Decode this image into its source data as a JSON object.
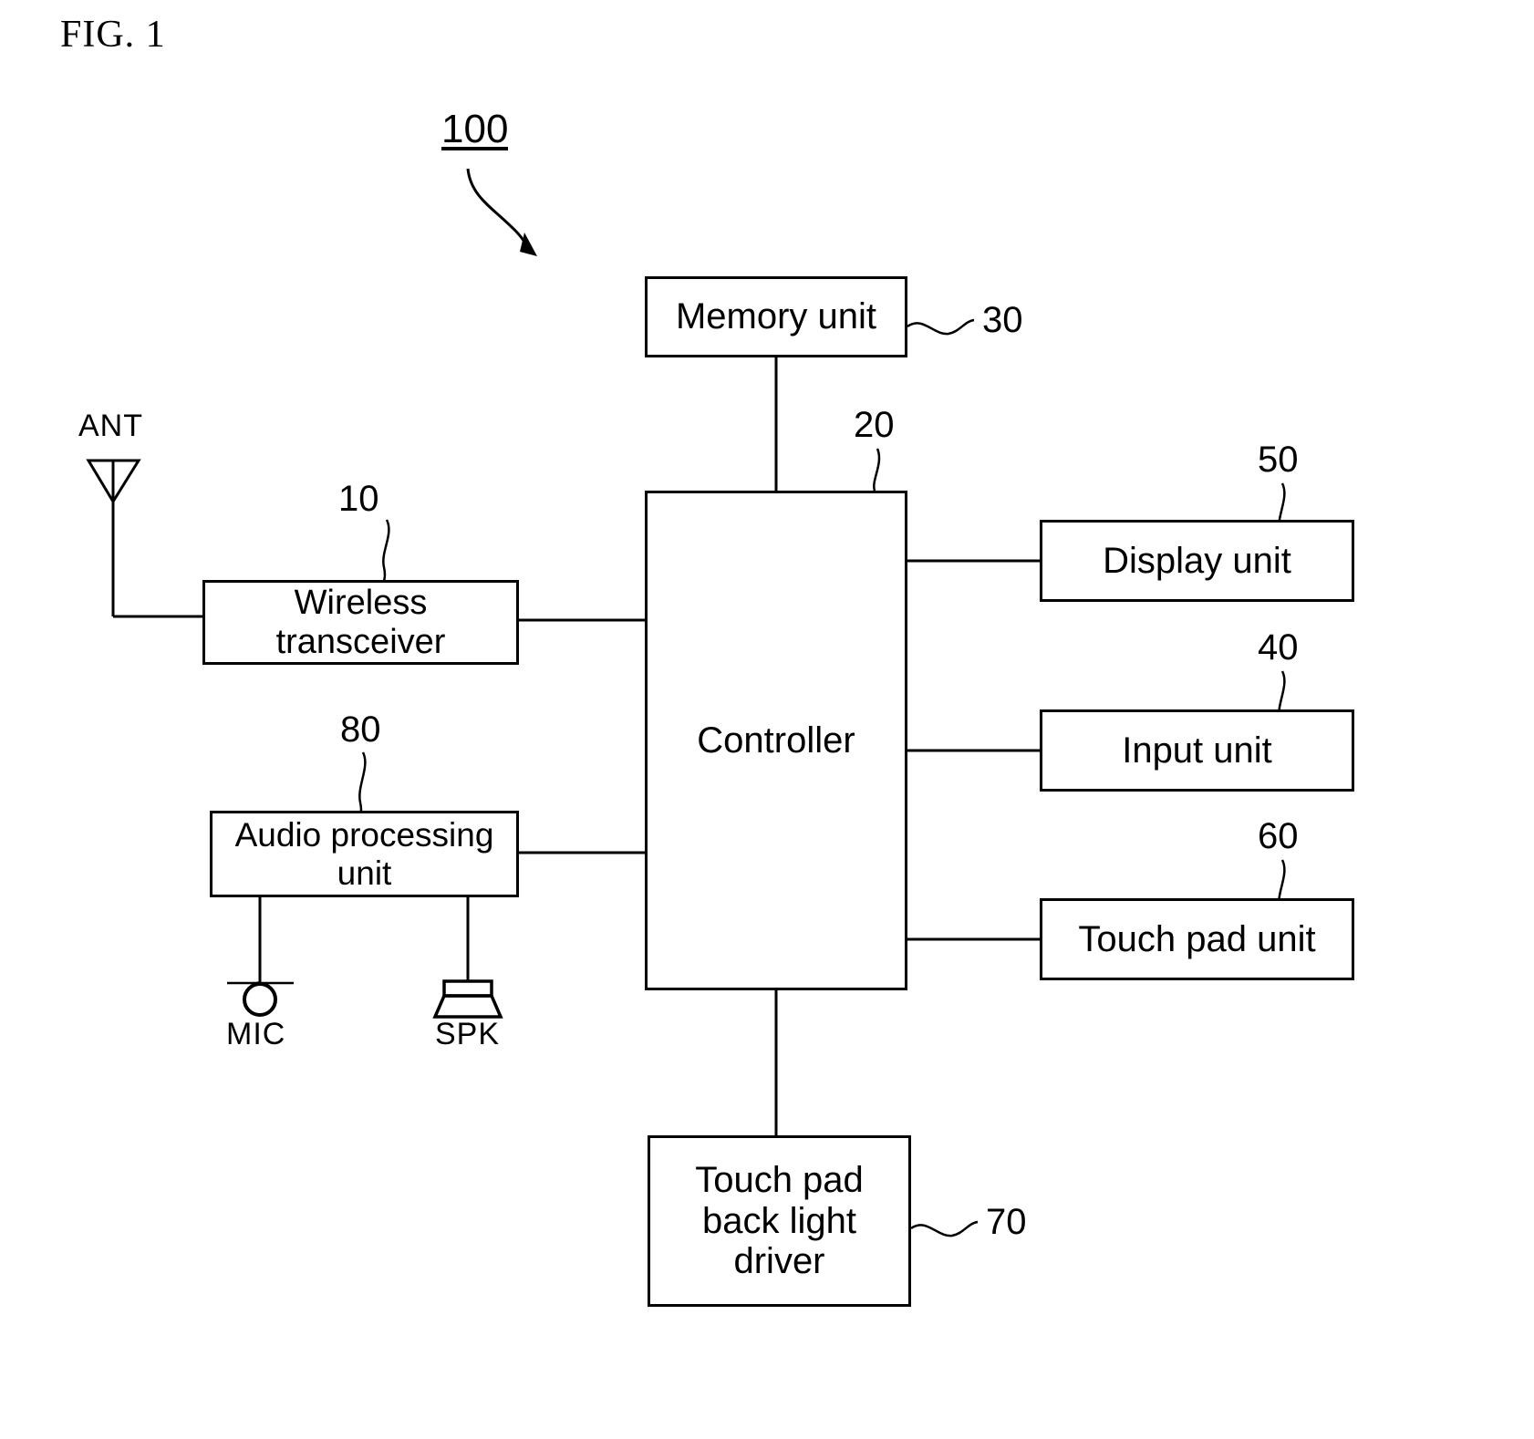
{
  "figure": {
    "title": "FIG. 1",
    "system_ref": "100"
  },
  "blocks": [
    {
      "id": "memory-unit",
      "label": "Memory unit",
      "ref": "30"
    },
    {
      "id": "wireless-transceiver",
      "label": "Wireless\ntransceiver",
      "ref": "10"
    },
    {
      "id": "audio-processing-unit",
      "label": "Audio processing\nunit",
      "ref": "80"
    },
    {
      "id": "controller",
      "label": "Controller",
      "ref": "20"
    },
    {
      "id": "display-unit",
      "label": "Display unit",
      "ref": "50"
    },
    {
      "id": "input-unit",
      "label": "Input unit",
      "ref": "40"
    },
    {
      "id": "touch-pad-unit",
      "label": "Touch pad unit",
      "ref": "60"
    },
    {
      "id": "touch-pad-back-light-driver",
      "label": "Touch pad\nback light\ndriver",
      "ref": "70"
    }
  ],
  "block_text": {
    "memory_unit": "Memory unit",
    "wireless_transceiver": "Wireless\ntransceiver",
    "audio_processing_unit": "Audio processing\nunit",
    "controller": "Controller",
    "display_unit": "Display unit",
    "input_unit": "Input unit",
    "touch_pad_unit": "Touch pad unit",
    "touch_pad_back_light_driver": "Touch pad\nback light\ndriver"
  },
  "refs": {
    "system": "100",
    "wireless_transceiver": "10",
    "controller": "20",
    "memory_unit": "30",
    "input_unit": "40",
    "display_unit": "50",
    "touch_pad_unit": "60",
    "touch_pad_back_light_driver": "70",
    "audio_processing_unit": "80"
  },
  "symbols": {
    "antenna": "ANT",
    "microphone": "MIC",
    "speaker": "SPK"
  },
  "colors": {
    "stroke": "#000000",
    "background": "#ffffff"
  }
}
